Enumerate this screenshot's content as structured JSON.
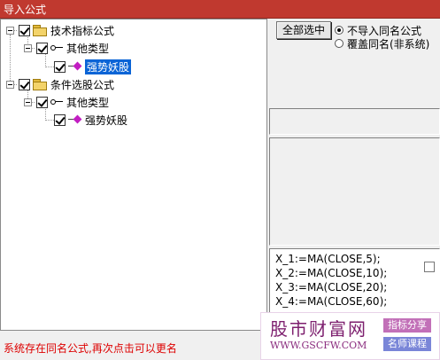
{
  "window": {
    "title": "导入公式"
  },
  "tree": {
    "groups": [
      {
        "label": "技术指标公式",
        "child": {
          "label": "其他类型",
          "leaf": "强势妖股"
        }
      },
      {
        "label": "条件选股公式",
        "child": {
          "label": "其他类型",
          "leaf": "强势妖股"
        }
      }
    ]
  },
  "controls": {
    "select_all_label": "全部选中",
    "radio_no_import": "不导入同名公式",
    "radio_overwrite": "覆盖同名(非系统)"
  },
  "code": {
    "lines": [
      "X_1:=MA(CLOSE,5);",
      "X_2:=MA(CLOSE,10);",
      "X_3:=MA(CLOSE,20);",
      "X_4:=MA(CLOSE,60);"
    ]
  },
  "status": {
    "message": "系统存在同名公式,再次点击可以更名"
  },
  "watermark": {
    "brand": "股市财富网",
    "url": "WWW.GSCFW.COM",
    "tag1": "指标分享",
    "tag2": "名师课程"
  }
}
